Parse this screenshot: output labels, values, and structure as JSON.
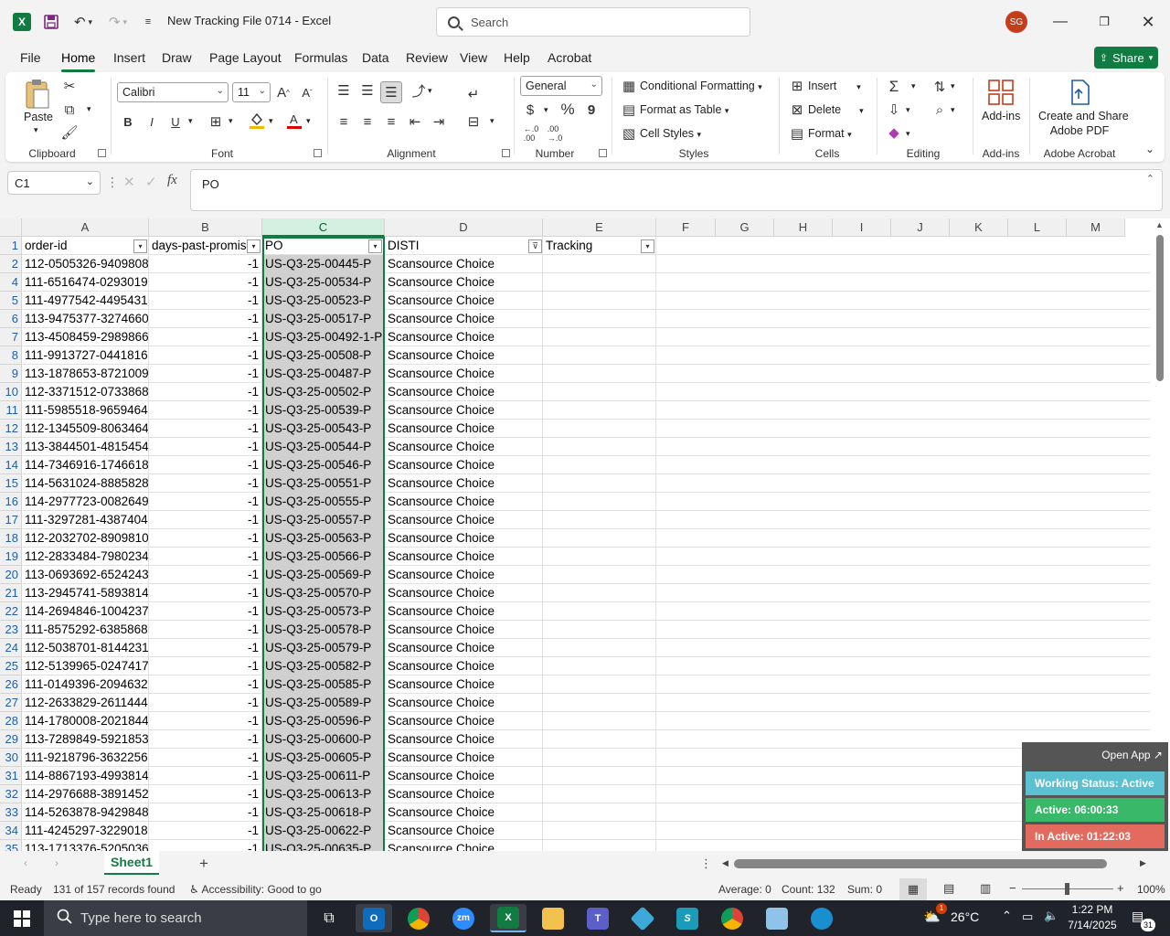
{
  "title_bar": {
    "app_icon": "excel-logo",
    "doc_title": "New Tracking File 0714  -  Excel",
    "search_placeholder": "Search",
    "avatar_initials": "SG"
  },
  "tabs": [
    "File",
    "Home",
    "Insert",
    "Draw",
    "Page Layout",
    "Formulas",
    "Data",
    "Review",
    "View",
    "Help",
    "Acrobat"
  ],
  "active_tab": "Home",
  "share_label": "Share",
  "ribbon": {
    "clipboard": {
      "paste": "Paste",
      "label": "Clipboard"
    },
    "font": {
      "name": "Calibri",
      "size": "11",
      "label": "Font",
      "bold": "B",
      "italic": "I",
      "underline": "U"
    },
    "alignment": {
      "label": "Alignment"
    },
    "number": {
      "format": "General",
      "label": "Number",
      "currency": "$",
      "percent": "%",
      "comma": "9"
    },
    "styles": {
      "conditional": "Conditional Formatting",
      "format_table": "Format as Table",
      "cell_styles": "Cell Styles",
      "label": "Styles"
    },
    "cells": {
      "insert": "Insert",
      "delete": "Delete",
      "format": "Format",
      "label": "Cells"
    },
    "editing": {
      "label": "Editing"
    },
    "addins": {
      "button": "Add-ins",
      "label": "Add-ins"
    },
    "acrobat": {
      "button_line1": "Create and Share",
      "button_line2": "Adobe PDF",
      "label": "Adobe Acrobat"
    }
  },
  "formula_bar": {
    "name_box": "C1",
    "fx": "fx",
    "content": "PO"
  },
  "columns": [
    "A",
    "B",
    "C",
    "D",
    "E",
    "F",
    "G",
    "H",
    "I",
    "J",
    "K",
    "L",
    "M"
  ],
  "selected_column": "C",
  "headers": {
    "a": "order-id",
    "b": "days-past-promis",
    "c": "PO",
    "d": "DISTI",
    "e": "Tracking"
  },
  "rows": [
    {
      "n": "2",
      "a": "112-0505326-9409808",
      "b": "-1",
      "c": "US-Q3-25-00445-P",
      "d": "Scansource Choice"
    },
    {
      "n": "4",
      "a": "111-6516474-0293019",
      "b": "-1",
      "c": "US-Q3-25-00534-P",
      "d": "Scansource Choice"
    },
    {
      "n": "5",
      "a": "111-4977542-4495431",
      "b": "-1",
      "c": "US-Q3-25-00523-P",
      "d": "Scansource Choice"
    },
    {
      "n": "6",
      "a": "113-9475377-3274660",
      "b": "-1",
      "c": "US-Q3-25-00517-P",
      "d": "Scansource Choice"
    },
    {
      "n": "7",
      "a": "113-4508459-2989866",
      "b": "-1",
      "c": "US-Q3-25-00492-1-P",
      "d": "Scansource Choice"
    },
    {
      "n": "8",
      "a": "111-9913727-0441816",
      "b": "-1",
      "c": "US-Q3-25-00508-P",
      "d": "Scansource Choice"
    },
    {
      "n": "9",
      "a": "113-1878653-8721009",
      "b": "-1",
      "c": "US-Q3-25-00487-P",
      "d": "Scansource Choice"
    },
    {
      "n": "10",
      "a": "112-3371512-0733868",
      "b": "-1",
      "c": "US-Q3-25-00502-P",
      "d": "Scansource Choice"
    },
    {
      "n": "11",
      "a": "111-5985518-9659464",
      "b": "-1",
      "c": "US-Q3-25-00539-P",
      "d": "Scansource Choice"
    },
    {
      "n": "12",
      "a": "112-1345509-8063464",
      "b": "-1",
      "c": "US-Q3-25-00543-P",
      "d": "Scansource Choice"
    },
    {
      "n": "13",
      "a": "113-3844501-4815454",
      "b": "-1",
      "c": "US-Q3-25-00544-P",
      "d": "Scansource Choice"
    },
    {
      "n": "14",
      "a": "114-7346916-1746618",
      "b": "-1",
      "c": "US-Q3-25-00546-P",
      "d": "Scansource Choice"
    },
    {
      "n": "15",
      "a": "114-5631024-8885828",
      "b": "-1",
      "c": "US-Q3-25-00551-P",
      "d": "Scansource Choice"
    },
    {
      "n": "16",
      "a": "114-2977723-0082649",
      "b": "-1",
      "c": "US-Q3-25-00555-P",
      "d": "Scansource Choice"
    },
    {
      "n": "17",
      "a": "111-3297281-4387404",
      "b": "-1",
      "c": "US-Q3-25-00557-P",
      "d": "Scansource Choice"
    },
    {
      "n": "18",
      "a": "112-2032702-8909810",
      "b": "-1",
      "c": "US-Q3-25-00563-P",
      "d": "Scansource Choice"
    },
    {
      "n": "19",
      "a": "112-2833484-7980234",
      "b": "-1",
      "c": "US-Q3-25-00566-P",
      "d": "Scansource Choice"
    },
    {
      "n": "20",
      "a": "113-0693692-6524243",
      "b": "-1",
      "c": "US-Q3-25-00569-P",
      "d": "Scansource Choice"
    },
    {
      "n": "21",
      "a": "113-2945741-5893814",
      "b": "-1",
      "c": "US-Q3-25-00570-P",
      "d": "Scansource Choice"
    },
    {
      "n": "22",
      "a": "114-2694846-1004237",
      "b": "-1",
      "c": "US-Q3-25-00573-P",
      "d": "Scansource Choice"
    },
    {
      "n": "23",
      "a": "111-8575292-6385868",
      "b": "-1",
      "c": "US-Q3-25-00578-P",
      "d": "Scansource Choice"
    },
    {
      "n": "24",
      "a": "112-5038701-8144231",
      "b": "-1",
      "c": "US-Q3-25-00579-P",
      "d": "Scansource Choice"
    },
    {
      "n": "25",
      "a": "112-5139965-0247417",
      "b": "-1",
      "c": "US-Q3-25-00582-P",
      "d": "Scansource Choice"
    },
    {
      "n": "26",
      "a": "111-0149396-2094632",
      "b": "-1",
      "c": "US-Q3-25-00585-P",
      "d": "Scansource Choice"
    },
    {
      "n": "27",
      "a": "112-2633829-2611444",
      "b": "-1",
      "c": "US-Q3-25-00589-P",
      "d": "Scansource Choice"
    },
    {
      "n": "28",
      "a": "114-1780008-2021844",
      "b": "-1",
      "c": "US-Q3-25-00596-P",
      "d": "Scansource Choice"
    },
    {
      "n": "29",
      "a": "113-7289849-5921853",
      "b": "-1",
      "c": "US-Q3-25-00600-P",
      "d": "Scansource Choice"
    },
    {
      "n": "30",
      "a": "111-9218796-3632256",
      "b": "-1",
      "c": "US-Q3-25-00605-P",
      "d": "Scansource Choice"
    },
    {
      "n": "31",
      "a": "114-8867193-4993814",
      "b": "-1",
      "c": "US-Q3-25-00611-P",
      "d": "Scansource Choice"
    },
    {
      "n": "32",
      "a": "114-2976688-3891452",
      "b": "-1",
      "c": "US-Q3-25-00613-P",
      "d": "Scansource Choice"
    },
    {
      "n": "33",
      "a": "114-5263878-9429848",
      "b": "-1",
      "c": "US-Q3-25-00618-P",
      "d": "Scansource Choice"
    },
    {
      "n": "34",
      "a": "111-4245297-3229018",
      "b": "-1",
      "c": "US-Q3-25-00622-P",
      "d": "Scansource Choice"
    },
    {
      "n": "35",
      "a": "113-1713376-5205036",
      "b": "-1",
      "c": "US-Q3-25-00635-P",
      "d": "Scansource Choice"
    }
  ],
  "widget": {
    "open_app": "Open App ↗",
    "status": "Working Status: Active",
    "active": "Active: 06:00:33",
    "inactive": "In Active: 01:22:03",
    "colors": {
      "status": "#5bc0cf",
      "active": "#39b86a",
      "inactive": "#e26a5e"
    }
  },
  "sheet_tab": "Sheet1",
  "status_bar": {
    "ready": "Ready",
    "records": "131 of 157 records found",
    "accessibility": "Accessibility: Good to go",
    "average": "Average: 0",
    "count": "Count: 132",
    "sum": "Sum: 0",
    "zoom": "100%"
  },
  "taskbar": {
    "search_placeholder": "Type here to search",
    "temperature": "26°C",
    "time": "1:22 PM",
    "date": "7/14/2025",
    "notifications": "31",
    "weather_badge": "1"
  },
  "accent": "#107c41"
}
